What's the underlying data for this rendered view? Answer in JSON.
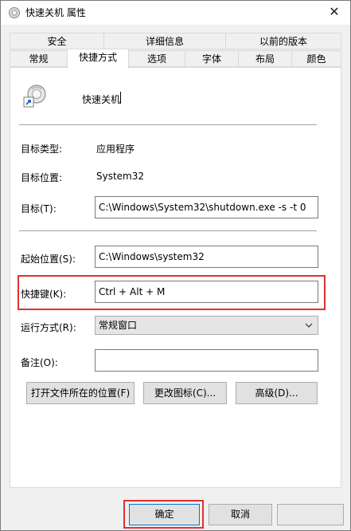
{
  "window": {
    "title": "快速关机 属性",
    "close_glyph": "✕"
  },
  "tabs": {
    "row1": [
      {
        "label": "安全"
      },
      {
        "label": "详细信息"
      },
      {
        "label": "以前的版本"
      }
    ],
    "row2": [
      {
        "label": "常规"
      },
      {
        "label": "快捷方式"
      },
      {
        "label": "选项"
      },
      {
        "label": "字体"
      },
      {
        "label": "布局"
      },
      {
        "label": "颜色"
      }
    ],
    "active": "快捷方式"
  },
  "shortcut": {
    "name": "快速关机"
  },
  "fields": {
    "target_type_label": "目标类型:",
    "target_type_value": "应用程序",
    "target_location_label": "目标位置:",
    "target_location_value": "System32",
    "target_label": "目标(T):",
    "target_value": "C:\\Windows\\System32\\shutdown.exe -s -t 0",
    "start_in_label": "起始位置(S):",
    "start_in_value": "C:\\Windows\\system32",
    "hotkey_label": "快捷键(K):",
    "hotkey_value": "Ctrl + Alt + M",
    "run_label": "运行方式(R):",
    "run_value": "常规窗口",
    "comment_label": "备注(O):",
    "comment_value": ""
  },
  "buttons": {
    "open_location": "打开文件所在的位置(F)",
    "change_icon": "更改图标(C)...",
    "advanced": "高级(D)...",
    "ok": "确定",
    "cancel": "取消"
  },
  "colors": {
    "highlight": "#e03030",
    "focus": "#0078d7"
  }
}
